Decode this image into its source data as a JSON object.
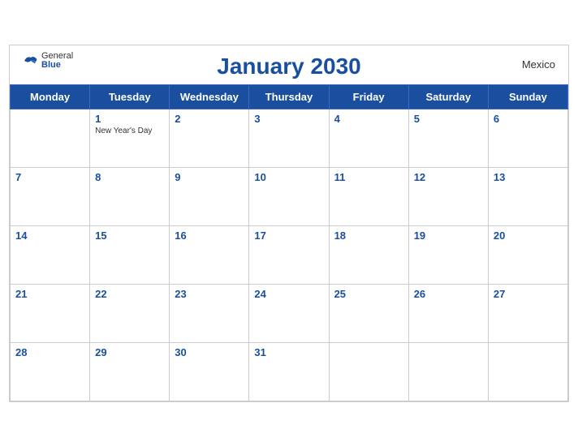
{
  "header": {
    "title": "January 2030",
    "country": "Mexico",
    "logo_general": "General",
    "logo_blue": "Blue"
  },
  "days_of_week": [
    "Monday",
    "Tuesday",
    "Wednesday",
    "Thursday",
    "Friday",
    "Saturday",
    "Sunday"
  ],
  "weeks": [
    [
      {
        "day": "",
        "empty": true
      },
      {
        "day": "1",
        "holiday": "New Year's Day"
      },
      {
        "day": "2",
        "holiday": ""
      },
      {
        "day": "3",
        "holiday": ""
      },
      {
        "day": "4",
        "holiday": ""
      },
      {
        "day": "5",
        "holiday": ""
      },
      {
        "day": "6",
        "holiday": ""
      }
    ],
    [
      {
        "day": "7",
        "holiday": ""
      },
      {
        "day": "8",
        "holiday": ""
      },
      {
        "day": "9",
        "holiday": ""
      },
      {
        "day": "10",
        "holiday": ""
      },
      {
        "day": "11",
        "holiday": ""
      },
      {
        "day": "12",
        "holiday": ""
      },
      {
        "day": "13",
        "holiday": ""
      }
    ],
    [
      {
        "day": "14",
        "holiday": ""
      },
      {
        "day": "15",
        "holiday": ""
      },
      {
        "day": "16",
        "holiday": ""
      },
      {
        "day": "17",
        "holiday": ""
      },
      {
        "day": "18",
        "holiday": ""
      },
      {
        "day": "19",
        "holiday": ""
      },
      {
        "day": "20",
        "holiday": ""
      }
    ],
    [
      {
        "day": "21",
        "holiday": ""
      },
      {
        "day": "22",
        "holiday": ""
      },
      {
        "day": "23",
        "holiday": ""
      },
      {
        "day": "24",
        "holiday": ""
      },
      {
        "day": "25",
        "holiday": ""
      },
      {
        "day": "26",
        "holiday": ""
      },
      {
        "day": "27",
        "holiday": ""
      }
    ],
    [
      {
        "day": "28",
        "holiday": ""
      },
      {
        "day": "29",
        "holiday": ""
      },
      {
        "day": "30",
        "holiday": ""
      },
      {
        "day": "31",
        "holiday": ""
      },
      {
        "day": "",
        "empty": true
      },
      {
        "day": "",
        "empty": true
      },
      {
        "day": "",
        "empty": true
      }
    ]
  ]
}
